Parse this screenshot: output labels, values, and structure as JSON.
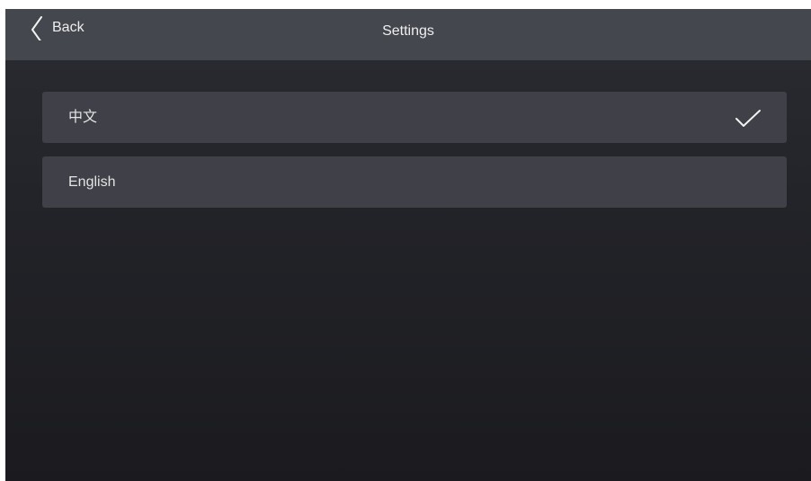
{
  "header": {
    "back_label": "Back",
    "title": "Settings"
  },
  "languages": [
    {
      "label": "中文",
      "selected": true
    },
    {
      "label": "English",
      "selected": false
    }
  ],
  "icons": {
    "back": "chevron-left-icon",
    "selected": "checkmark-icon"
  },
  "colors": {
    "topbar": "#45474f",
    "background_top": "#2a2c32",
    "background_bottom": "#1b1b1f",
    "option_background": "#3f4048",
    "text": "#eeeeee"
  }
}
